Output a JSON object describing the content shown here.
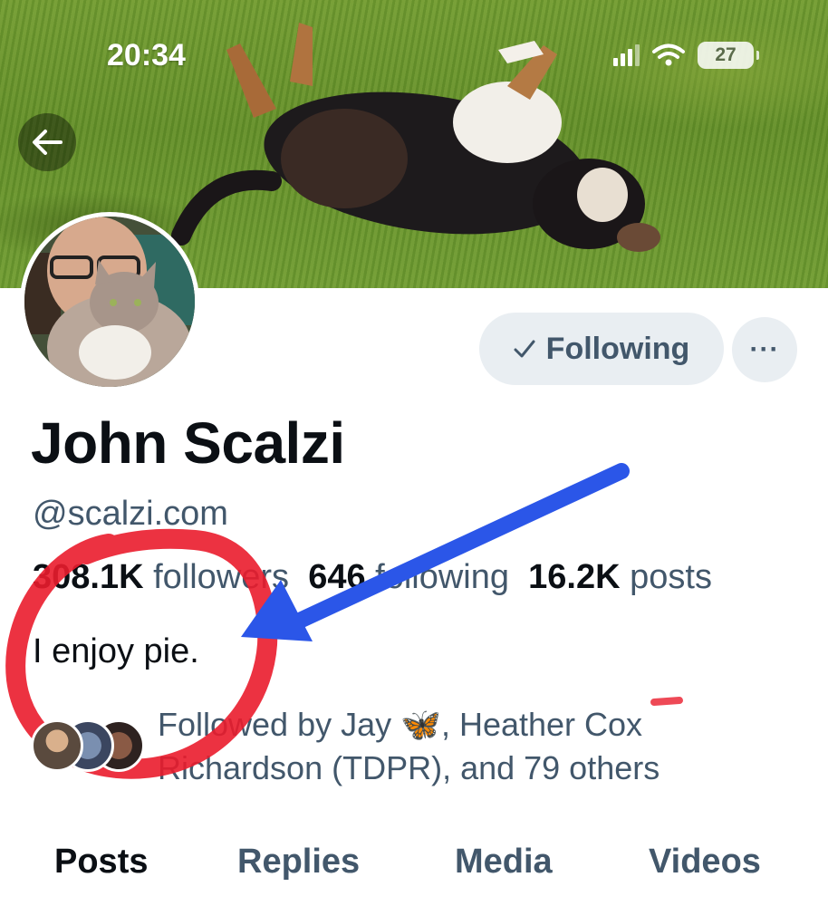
{
  "status_bar": {
    "time": "20:34",
    "battery": "27"
  },
  "profile": {
    "name": "John Scalzi",
    "handle": "@scalzi.com",
    "followers_count": "308.1K",
    "followers_label": "followers",
    "following_count": "646",
    "following_label": "following",
    "posts_count": "16.2K",
    "posts_label": "posts",
    "bio": "I enjoy pie."
  },
  "actions": {
    "following_label": "Following",
    "more_label": "···"
  },
  "followed_by": {
    "prefix": "Followed by Jay ",
    "emoji": "🦋",
    "suffix": ", Heather Cox Richardson (TDPR), and 79 others"
  },
  "tabs": [
    "Posts",
    "Replies",
    "Media",
    "Videos"
  ],
  "colors": {
    "accent_text": "#42576b",
    "button_bg": "#e9eef2",
    "annotation_circle": "#ea1c2c",
    "annotation_arrow": "#2b56e8"
  },
  "icons": [
    "back-arrow-icon",
    "checkmark-icon",
    "more-icon",
    "signal-icon",
    "wifi-icon",
    "battery-icon"
  ]
}
